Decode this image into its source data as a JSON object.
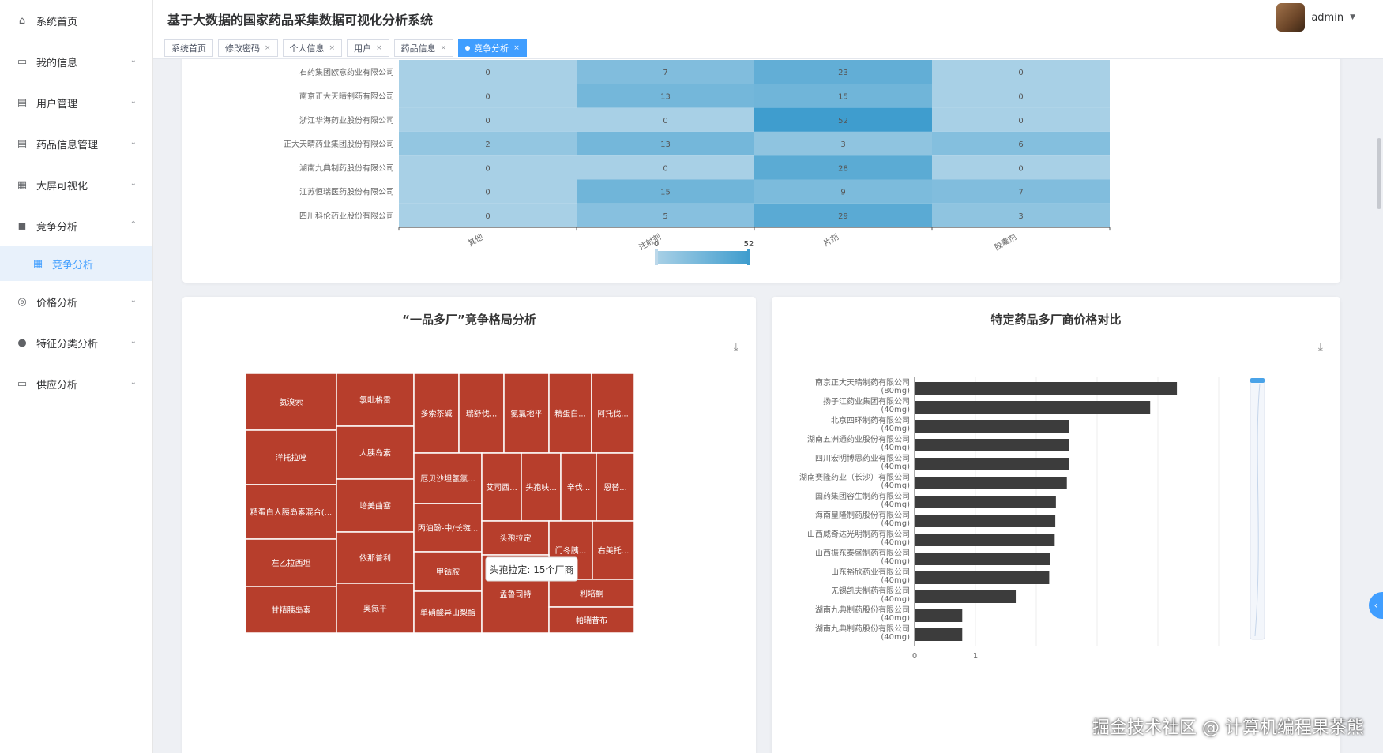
{
  "app": {
    "title": "基于大数据的国家药品采集数据可视化分析系统",
    "user": "admin",
    "watermark": "掘金技术社区 @ 计算机编程果茶熊"
  },
  "sidebar": {
    "items": [
      {
        "label": "系统首页",
        "icon": "home-icon"
      },
      {
        "label": "我的信息",
        "icon": "card-icon",
        "arrow": true
      },
      {
        "label": "用户管理",
        "icon": "clipboard-icon",
        "arrow": true
      },
      {
        "label": "药品信息管理",
        "icon": "clipboard-icon",
        "arrow": true
      },
      {
        "label": "大屏可视化",
        "icon": "grid-icon",
        "arrow": true
      },
      {
        "label": "竞争分析",
        "icon": "camera-icon",
        "arrow": true,
        "open": true
      },
      {
        "label": "竞争分析",
        "icon": "grid-icon",
        "sub": true
      },
      {
        "label": "价格分析",
        "icon": "coin-icon",
        "arrow": true
      },
      {
        "label": "特征分类分析",
        "icon": "user-icon",
        "arrow": true
      },
      {
        "label": "供应分析",
        "icon": "card-icon",
        "arrow": true
      }
    ]
  },
  "tabs": [
    {
      "label": "系统首页",
      "closable": false
    },
    {
      "label": "修改密码",
      "closable": true
    },
    {
      "label": "个人信息",
      "closable": true
    },
    {
      "label": "用户",
      "closable": true
    },
    {
      "label": "药品信息",
      "closable": true
    },
    {
      "label": "竞争分析",
      "closable": true,
      "active": true
    }
  ],
  "chart_data": [
    {
      "type": "heatmap",
      "rows": [
        "石药集团欧意药业有限公司",
        "南京正大天晴制药有限公司",
        "浙江华海药业股份有限公司",
        "正大天晴药业集团股份有限公司",
        "湖南九典制药股份有限公司",
        "江苏恒瑞医药股份有限公司",
        "四川科伦药业股份有限公司"
      ],
      "columns": [
        "其他",
        "注射剂",
        "片剂",
        "胶囊剂"
      ],
      "values": [
        [
          0,
          7,
          23,
          0
        ],
        [
          0,
          13,
          15,
          0
        ],
        [
          0,
          0,
          52,
          0
        ],
        [
          2,
          13,
          3,
          6
        ],
        [
          0,
          0,
          28,
          0
        ],
        [
          0,
          15,
          9,
          7
        ],
        [
          0,
          5,
          29,
          3
        ]
      ],
      "visual_map": {
        "min": 0,
        "max": 52
      }
    },
    {
      "type": "treemap",
      "title": "“一品多厂”竞争格局分析",
      "tooltip": "头孢拉定: 15个厂商",
      "items": [
        {
          "name": "氨溴索"
        },
        {
          "name": "洋托拉唑"
        },
        {
          "name": "精蛋白人胰岛素混合(..."
        },
        {
          "name": "左乙拉西坦"
        },
        {
          "name": "甘精胰岛素"
        },
        {
          "name": "氯吡格雷"
        },
        {
          "name": "人胰岛素"
        },
        {
          "name": "培美曲塞"
        },
        {
          "name": "依那普利"
        },
        {
          "name": "奥氮平"
        },
        {
          "name": "多索茶碱"
        },
        {
          "name": "瑞舒伐..."
        },
        {
          "name": "氨氯地平"
        },
        {
          "name": "精蛋白..."
        },
        {
          "name": "阿托伐..."
        },
        {
          "name": "厄贝沙坦氢氯..."
        },
        {
          "name": "丙泊酚-中/长链..."
        },
        {
          "name": "甲钴胺"
        },
        {
          "name": "单硝酸异山梨酯"
        },
        {
          "name": "艾司西..."
        },
        {
          "name": "头孢呋..."
        },
        {
          "name": "辛伐..."
        },
        {
          "name": "恩替..."
        },
        {
          "name": "头孢拉定",
          "value": 15
        },
        {
          "name": "门冬胰..."
        },
        {
          "name": "右美托..."
        },
        {
          "name": "孟鲁司特"
        },
        {
          "name": "利培酮"
        },
        {
          "name": "帕瑞昔布"
        }
      ]
    },
    {
      "type": "bar",
      "orientation": "horizontal",
      "title": "特定药品多厂商价格对比",
      "categories": [
        "南京正大天晴制药有限公司(80mg)",
        "扬子江药业集团有限公司(40mg)",
        "北京四环制药有限公司(40mg)",
        "湖南五洲通药业股份有限公司(40mg)",
        "四川宏明博思药业有限公司(40mg)",
        "湖南赛隆药业（长沙）有限公司(40mg)",
        "国药集团容生制药有限公司(40mg)",
        "海南皇隆制药股份有限公司(40mg)",
        "山西威奇达光明制药有限公司(40mg)",
        "山西振东泰盛制药有限公司(40mg)",
        "山东裕欣药业有限公司(40mg)",
        "无锡凯夫制药有限公司(40mg)",
        "湖南九典制药股份有限公司(40mg)",
        "湖南九典制药股份有限公司(40mg)"
      ],
      "values": [
        4.3,
        3.86,
        2.53,
        2.53,
        2.53,
        2.49,
        2.31,
        2.3,
        2.29,
        2.21,
        2.2,
        1.65,
        0.77,
        0.77
      ],
      "xlim": [
        0,
        5
      ],
      "xticks": [
        "0",
        "1"
      ]
    }
  ]
}
